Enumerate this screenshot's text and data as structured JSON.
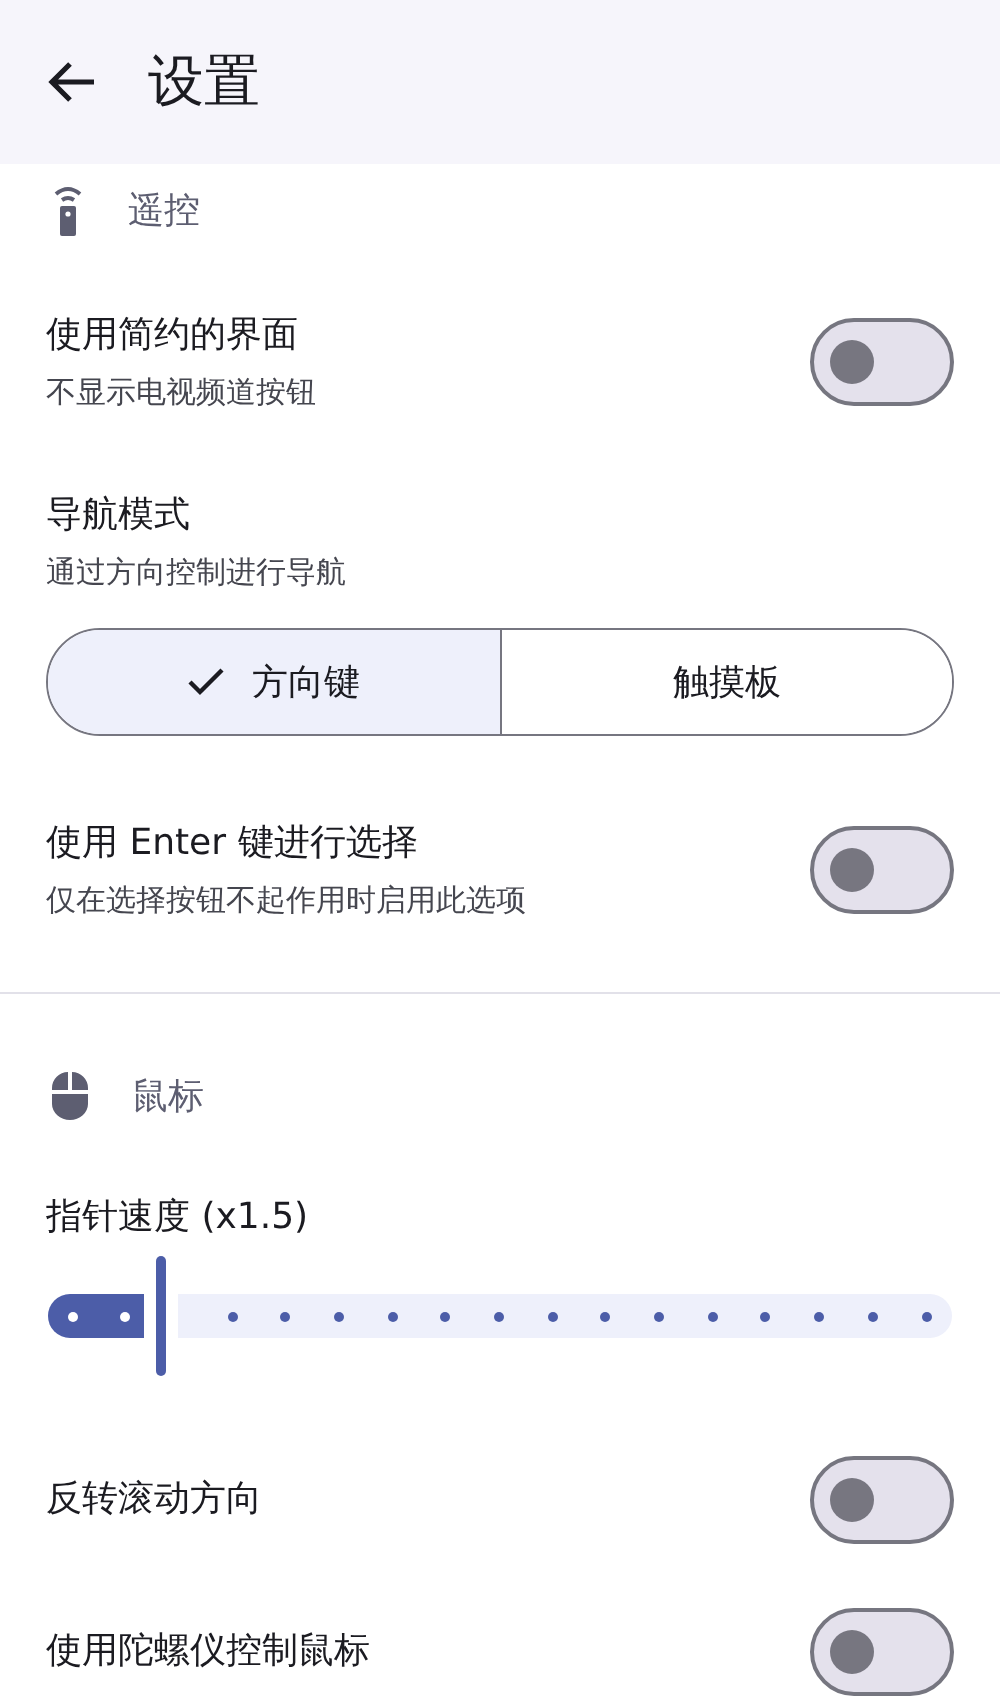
{
  "header": {
    "title": "设置"
  },
  "sections": [
    {
      "title": "遥控",
      "items": [
        {
          "kind": "switch",
          "title": "使用简约的界面",
          "subtitle": "不显示电视频道按钮",
          "on": false
        },
        {
          "kind": "segmented",
          "title": "导航模式",
          "subtitle": "通过方向控制进行导航",
          "options": [
            {
              "label": "方向键",
              "selected": true
            },
            {
              "label": "触摸板",
              "selected": false
            }
          ]
        },
        {
          "kind": "switch",
          "title": "使用 Enter 键进行选择",
          "subtitle": "仅在选择按钮不起作用时启用此选项",
          "on": false
        }
      ]
    },
    {
      "title": "鼠标",
      "items": [
        {
          "kind": "slider",
          "title": "指针速度 (x1.5)",
          "level": 0.125
        },
        {
          "kind": "switch",
          "title": "反转滚动方向",
          "on": false
        },
        {
          "kind": "switch",
          "title": "使用陀螺仪控制鼠标",
          "on": false
        }
      ]
    }
  ]
}
